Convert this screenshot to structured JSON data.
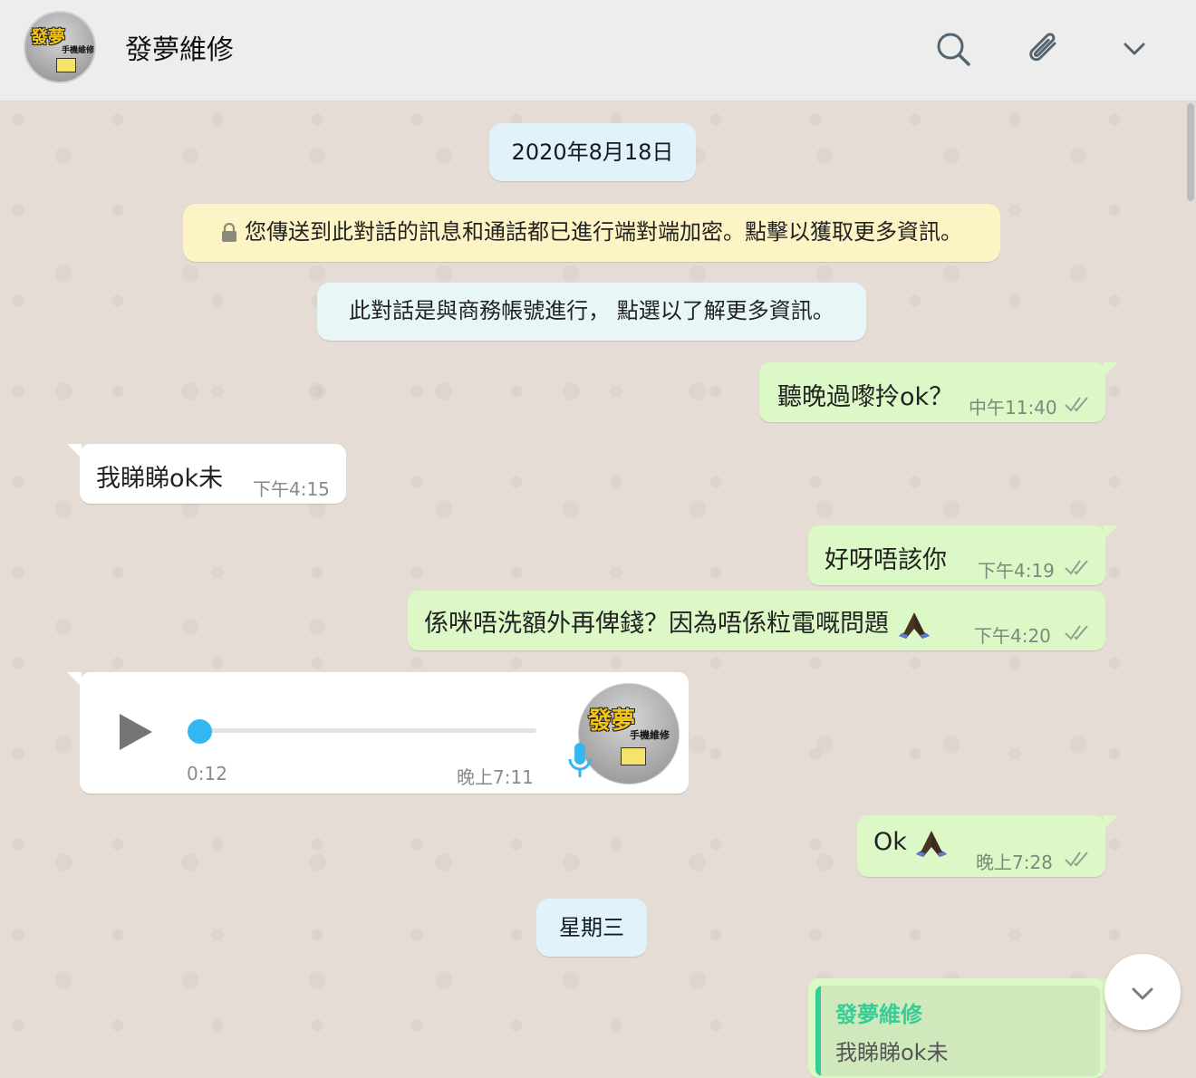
{
  "header": {
    "contact_name": "發夢維修",
    "avatar_text_main": "發夢",
    "avatar_text_sub": "手機維修",
    "icons": [
      "search-icon",
      "attach-icon",
      "chevron-down-icon"
    ]
  },
  "chat": {
    "date_label": "2020年8月18日",
    "encryption_notice": "您傳送到此對話的訊息和通話都已進行端對端加密。點擊以獲取更多資訊。",
    "business_notice": "此對話是與商務帳號進行， 點選以了解更多資訊。",
    "messages": [
      {
        "direction": "out",
        "text": "聽晚過嚟拎ok？",
        "time": "中午11:40",
        "status": "read"
      },
      {
        "direction": "in",
        "text": "我睇睇ok未",
        "time": "下午4:15"
      },
      {
        "direction": "out",
        "text": "好呀唔該你",
        "time": "下午4:19",
        "status": "read"
      },
      {
        "direction": "out",
        "text": "係咪唔洗額外再俾錢？因為唔係粒電嘅問題",
        "time": "下午4:20",
        "status": "read"
      },
      {
        "direction": "in",
        "type": "voice",
        "duration": "0:12",
        "time": "晚上7:11",
        "progress": 0
      },
      {
        "direction": "out",
        "text": "Ok",
        "time": "晚上7:28",
        "status": "read"
      }
    ],
    "day_label": "星期三",
    "quoted_reply": {
      "author": "發夢維修",
      "text": "我睇睇ok未"
    }
  },
  "colors": {
    "outgoing_bubble": "#dcf8c6",
    "incoming_bubble": "#ffffff",
    "read_ticks": "#8fa08f",
    "voice_accent": "#34b7f1",
    "quote_bar": "#35cd96"
  }
}
